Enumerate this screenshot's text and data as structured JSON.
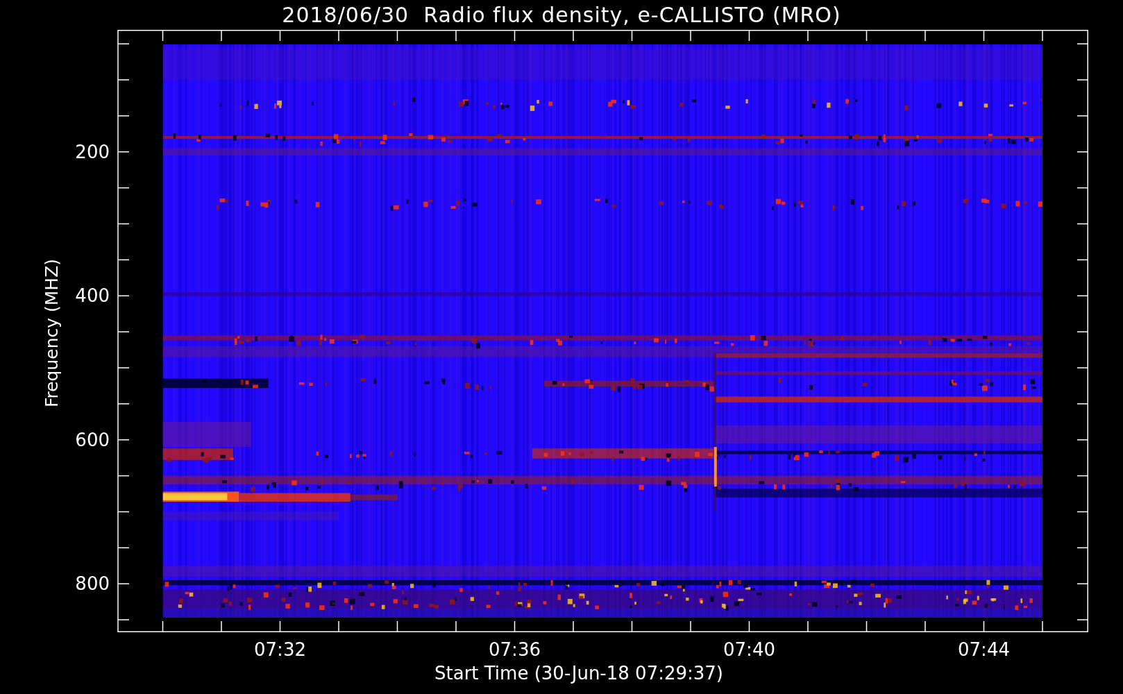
{
  "title": "2018/06/30  Radio flux density, e-CALLISTO (MRO)",
  "axes": {
    "ylabel": "Frequency (MHZ)",
    "xlabel": "Start Time (30-Jun-18 07:29:37)",
    "yticks": [
      "200",
      "400",
      "600",
      "800"
    ],
    "xticks": [
      "07:32",
      "07:36",
      "07:40",
      "07:44"
    ]
  }
}
